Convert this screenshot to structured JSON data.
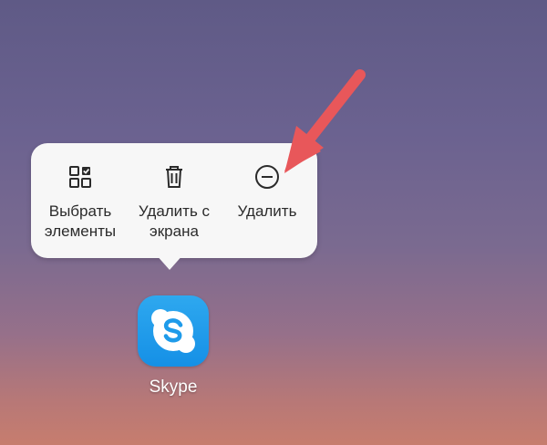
{
  "popup_menu": {
    "items": [
      {
        "label": "Выбрать\nэлементы",
        "icon": "select-items-icon"
      },
      {
        "label": "Удалить с\nэкрана",
        "icon": "trash-icon"
      },
      {
        "label": "Удалить",
        "icon": "minus-circle-icon"
      }
    ]
  },
  "app": {
    "label": "Skype",
    "icon": "skype-icon",
    "brand_color": "#1e9bea"
  },
  "annotation": {
    "arrow_color": "#e8575a"
  }
}
